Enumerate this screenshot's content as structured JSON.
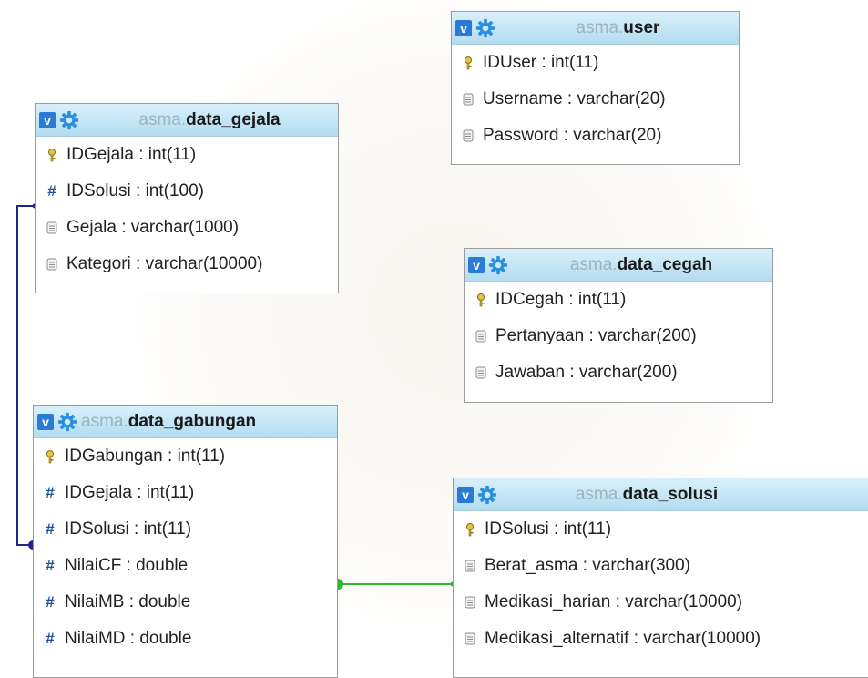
{
  "tables": {
    "user": {
      "schema": "asma.",
      "name": "user",
      "columns": [
        {
          "text": "IDUser : int(11)",
          "icon": "key-icon"
        },
        {
          "text": "Username : varchar(20)",
          "icon": "column-icon"
        },
        {
          "text": "Password : varchar(20)",
          "icon": "column-icon"
        }
      ]
    },
    "data_gejala": {
      "schema": "asma.",
      "name": "data_gejala",
      "columns": [
        {
          "text": "IDGejala : int(11)",
          "icon": "key-icon"
        },
        {
          "text": "IDSolusi : int(100)",
          "icon": "numeric-icon"
        },
        {
          "text": "Gejala : varchar(1000)",
          "icon": "column-icon"
        },
        {
          "text": "Kategori : varchar(10000)",
          "icon": "column-icon"
        }
      ]
    },
    "data_cegah": {
      "schema": "asma.",
      "name": "data_cegah",
      "columns": [
        {
          "text": "IDCegah : int(11)",
          "icon": "key-icon"
        },
        {
          "text": "Pertanyaan : varchar(200)",
          "icon": "column-icon"
        },
        {
          "text": "Jawaban : varchar(200)",
          "icon": "column-icon"
        }
      ]
    },
    "data_gabungan": {
      "schema": "asma.",
      "name": "data_gabungan",
      "columns": [
        {
          "text": "IDGabungan : int(11)",
          "icon": "key-icon"
        },
        {
          "text": "IDGejala : int(11)",
          "icon": "numeric-icon"
        },
        {
          "text": "IDSolusi : int(11)",
          "icon": "numeric-icon"
        },
        {
          "text": "NilaiCF : double",
          "icon": "numeric-icon"
        },
        {
          "text": "NilaiMB : double",
          "icon": "numeric-icon"
        },
        {
          "text": "NilaiMD : double",
          "icon": "numeric-icon"
        }
      ]
    },
    "data_solusi": {
      "schema": "asma.",
      "name": "data_solusi",
      "columns": [
        {
          "text": "IDSolusi : int(11)",
          "icon": "key-icon"
        },
        {
          "text": "Berat_asma : varchar(300)",
          "icon": "column-icon"
        },
        {
          "text": "Medikasi_harian : varchar(10000)",
          "icon": "column-icon"
        },
        {
          "text": "Medikasi_alternatif : varchar(10000)",
          "icon": "column-icon"
        }
      ]
    }
  },
  "header_button_label": "v",
  "colors": {
    "header_top": "#d9f0fb",
    "header_bottom": "#b3dcf0",
    "relation_blue": "#23238e",
    "relation_green": "#2fb52f",
    "schema_text": "#9fb3bf",
    "toggle_button": "#2a7bd6"
  }
}
